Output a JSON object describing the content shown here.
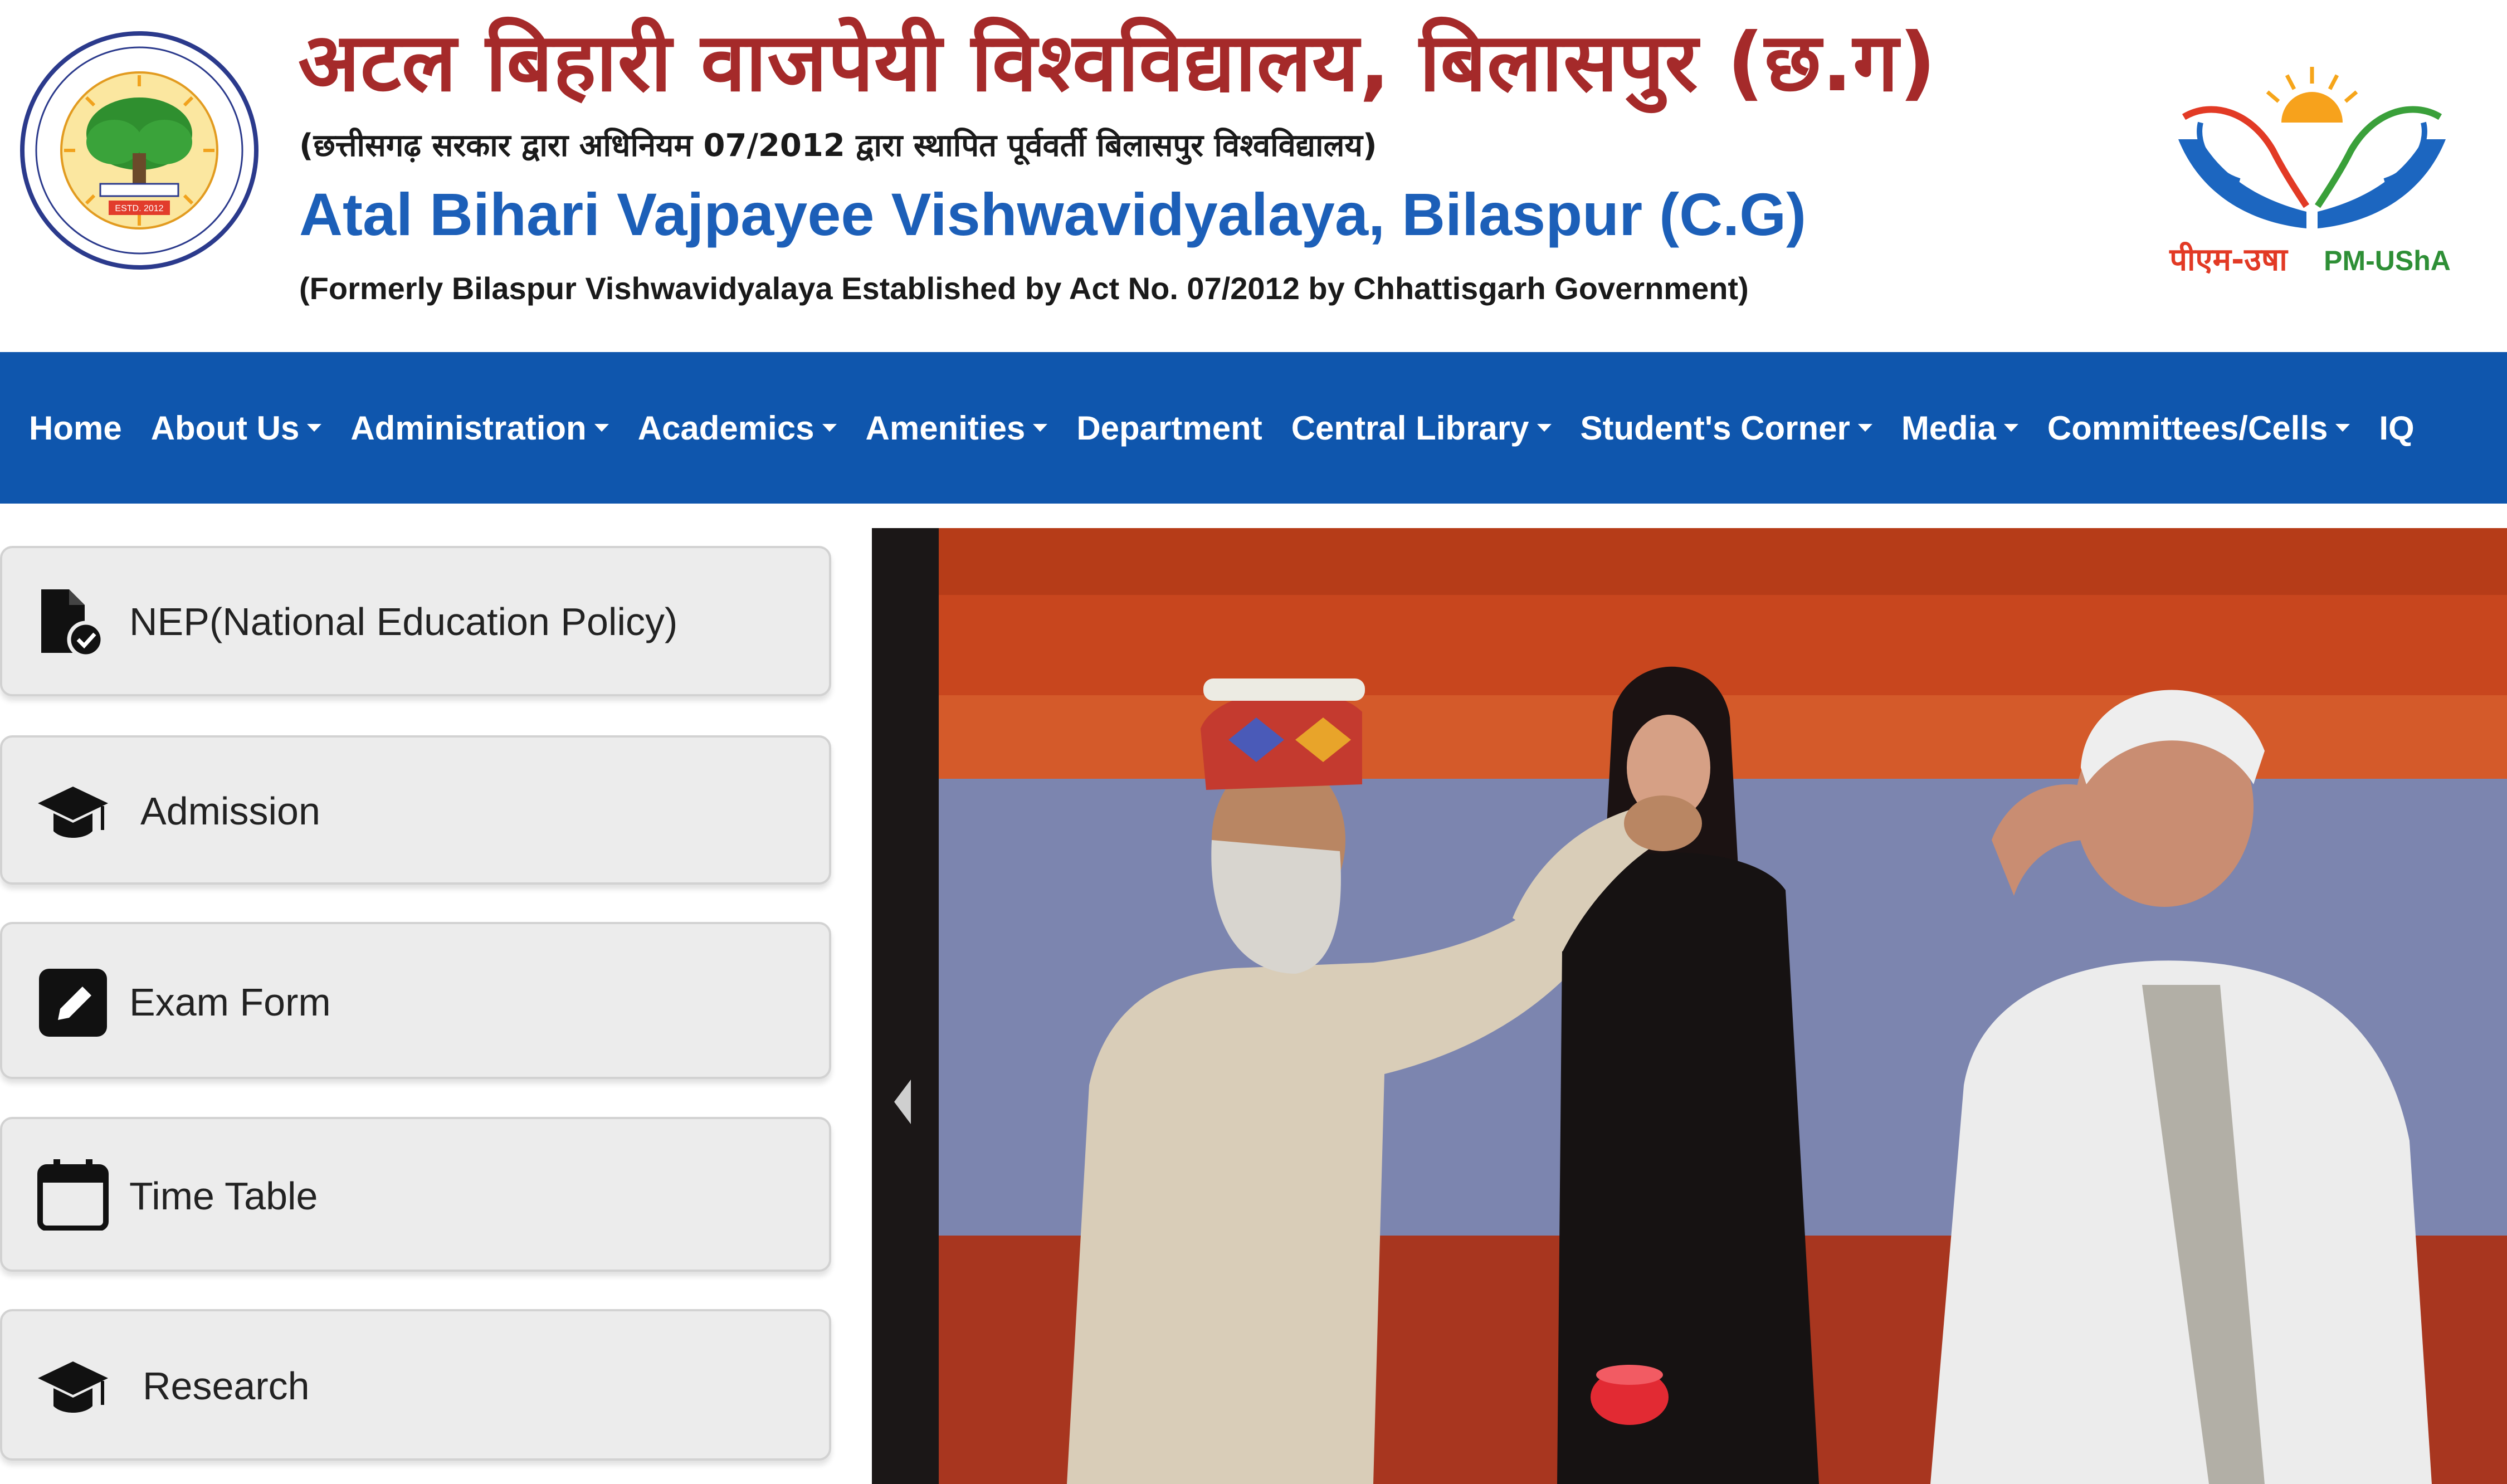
{
  "header": {
    "title_hindi": "अटल बिहारी वाजपेयी विश्वविद्यालय, बिलासपुर (छ.ग)",
    "subtitle_hindi": "(छत्तीसगढ़ सरकार द्वारा अधिनियम 07/2012 द्वारा स्थापित पूर्ववर्ती बिलासपुर विश्वविद्यालय)",
    "title_english": "Atal Bihari Vajpayee Vishwavidyalaya, Bilaspur (C.G)",
    "subtitle_english": "(Formerly Bilaspur Vishwavidyalaya Established by Act No. 07/2012 by Chhattisgarh Government)",
    "pm_logo_text_hindi": "पीएम-उषा",
    "pm_logo_text_english": "PM-UShA",
    "seal_year_text": "ESTD. 2012"
  },
  "nav": {
    "items": [
      {
        "label": "Home",
        "dropdown": false
      },
      {
        "label": "About Us",
        "dropdown": true
      },
      {
        "label": "Administration",
        "dropdown": true
      },
      {
        "label": "Academics",
        "dropdown": true
      },
      {
        "label": "Amenities",
        "dropdown": true
      },
      {
        "label": "Department",
        "dropdown": false
      },
      {
        "label": "Central Library",
        "dropdown": true
      },
      {
        "label": "Student's Corner",
        "dropdown": true
      },
      {
        "label": "Media",
        "dropdown": true
      },
      {
        "label": "Committees/Cells",
        "dropdown": true
      },
      {
        "label": "IQ",
        "dropdown": false
      }
    ]
  },
  "sidebar": {
    "items": [
      {
        "label": "NEP(National Education Policy)",
        "icon": "file-check-icon"
      },
      {
        "label": "Admission",
        "icon": "graduation-cap-icon"
      },
      {
        "label": "Exam Form",
        "icon": "edit-square-icon"
      },
      {
        "label": "Time Table",
        "icon": "calendar-icon"
      },
      {
        "label": "Research",
        "icon": "graduation-cap-icon"
      }
    ]
  },
  "slider": {
    "prev_icon": "chevron-left-icon"
  },
  "colors": {
    "nav_bg": "#0f56ad",
    "title_hindi": "#a52a2a",
    "title_english": "#1c5fb8",
    "sidebar_btn_bg": "#ececec"
  }
}
